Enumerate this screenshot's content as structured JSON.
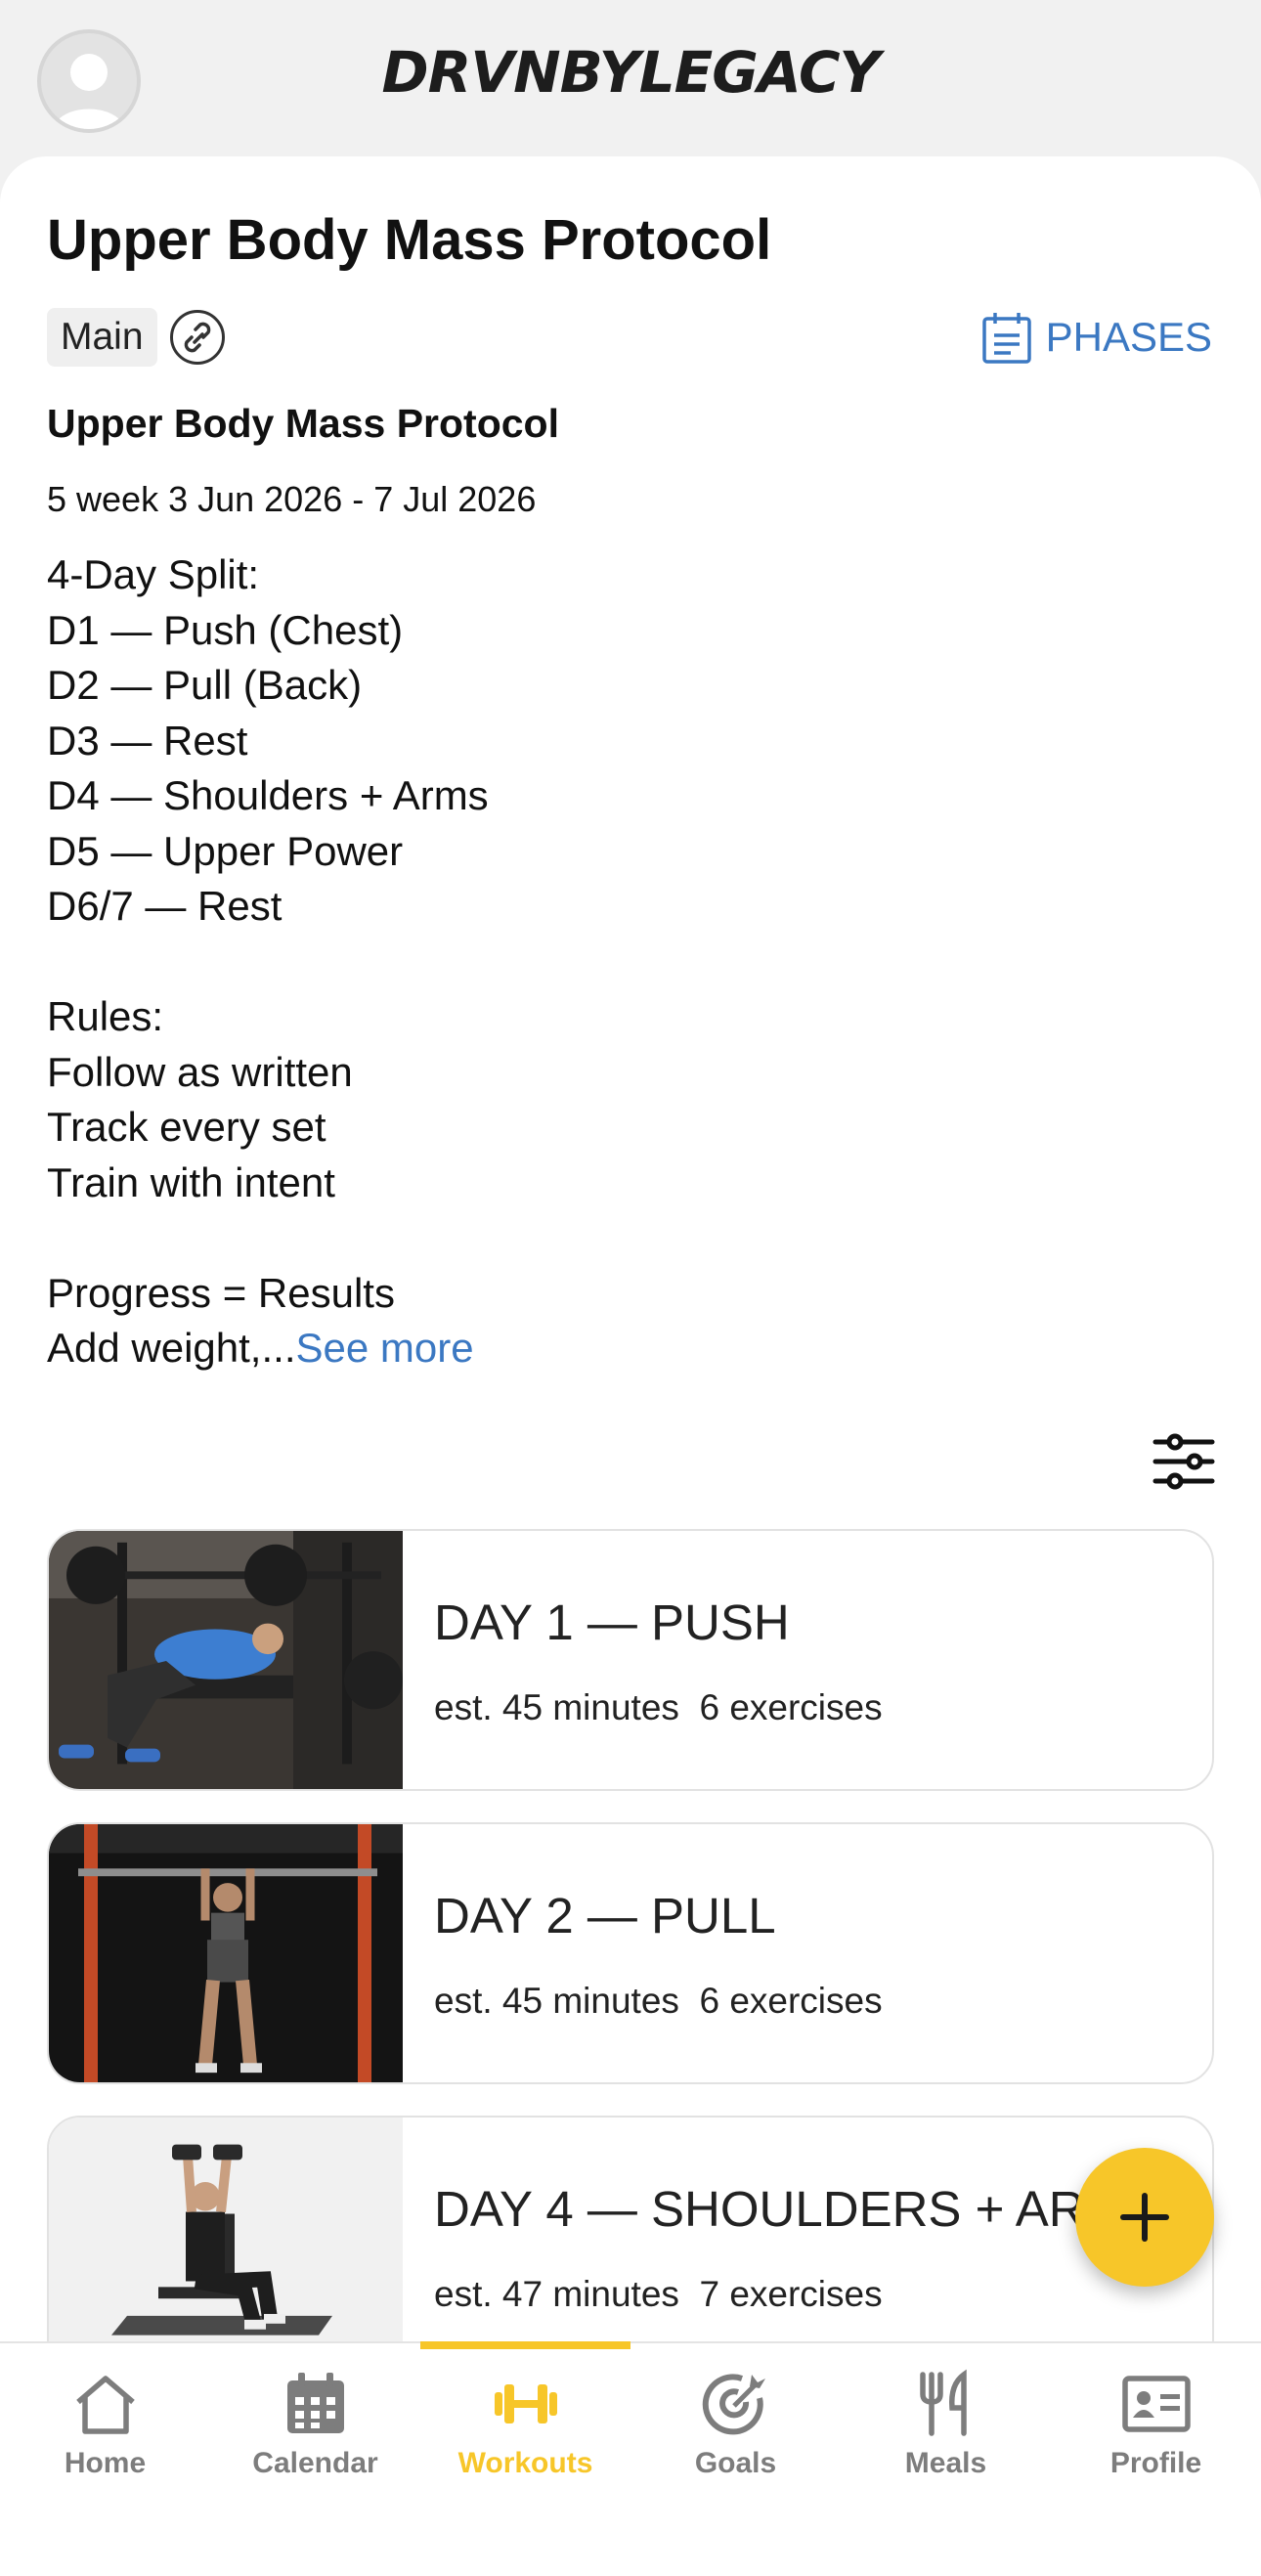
{
  "app": {
    "brand": "DRVNBYLEGACY"
  },
  "header": {
    "title": "Upper Body Mass Protocol",
    "tag": "Main",
    "phases_label": "PHASES"
  },
  "program": {
    "name": "Upper Body Mass Protocol",
    "dates": "5 week 3 Jun 2026 - 7 Jul 2026",
    "description": "4-Day Split:\nD1 — Push (Chest)\nD2 — Pull (Back)\nD3 — Rest\nD4 — Shoulders + Arms\nD5 — Upper Power\nD6/7 — Rest\n\nRules:\nFollow as written\nTrack every set\nTrain with intent\n\nProgress = Results\nAdd weight,...",
    "see_more": "See more"
  },
  "workouts": [
    {
      "name": "DAY 1 — PUSH",
      "meta": "est. 45 minutes  6 exercises"
    },
    {
      "name": "DAY 2 — PULL",
      "meta": "est. 45 minutes  6 exercises"
    },
    {
      "name": "DAY 4 — SHOULDERS + ARMS",
      "meta": "est. 47 minutes  7 exercises"
    }
  ],
  "nav": {
    "items": [
      {
        "label": "Home",
        "icon": "home-icon"
      },
      {
        "label": "Calendar",
        "icon": "calendar-icon"
      },
      {
        "label": "Workouts",
        "icon": "dumbbell-icon",
        "active": true
      },
      {
        "label": "Goals",
        "icon": "target-icon"
      },
      {
        "label": "Meals",
        "icon": "utensils-icon"
      },
      {
        "label": "Profile",
        "icon": "id-card-icon"
      }
    ]
  },
  "colors": {
    "accent": "#f7c629",
    "link": "#3b78c2",
    "inactive": "#7d7d7d"
  }
}
